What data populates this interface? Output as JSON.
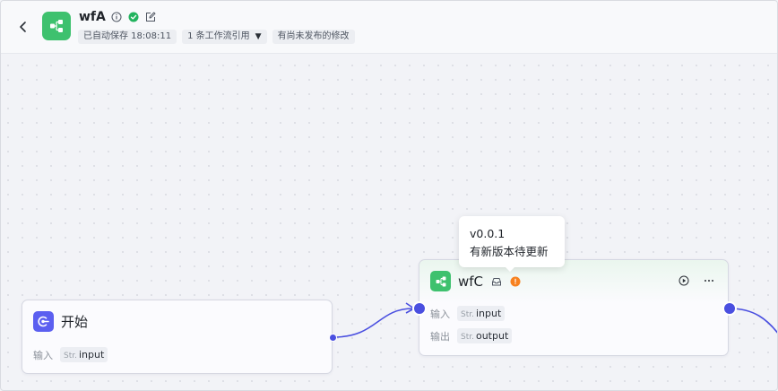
{
  "header": {
    "back_icon": "chevron-left-icon",
    "app_icon": "workflow-icon",
    "title": "wfA",
    "info_icon": "info-icon",
    "status_icon": "check-circle-icon",
    "edit_icon": "edit-icon",
    "tags": {
      "autosave": "已自动保存 18:08:11",
      "references": "1 条工作流引用",
      "unpublished": "有尚未发布的修改"
    }
  },
  "colors": {
    "brand_green": "#3ec16e",
    "start_purple": "#5b5ff0",
    "edge_blue": "#4a4fe0",
    "warning_orange": "#f7811f"
  },
  "nodes": {
    "start": {
      "icon": "start-icon",
      "title": "开始",
      "params": [
        {
          "label": "输入",
          "type": "Str.",
          "name": "input"
        }
      ]
    },
    "workflow": {
      "icon": "workflow-icon",
      "title": "wfC",
      "badge_icon": "inbox-icon",
      "warning_icon": "warning-icon",
      "run_icon": "play-circle-icon",
      "more_icon": "more-icon",
      "params": [
        {
          "label": "输入",
          "type": "Str.",
          "name": "input"
        },
        {
          "label": "输出",
          "type": "Str.",
          "name": "output"
        }
      ]
    }
  },
  "tooltip": {
    "version": "v0.0.1",
    "message": "有新版本待更新"
  }
}
